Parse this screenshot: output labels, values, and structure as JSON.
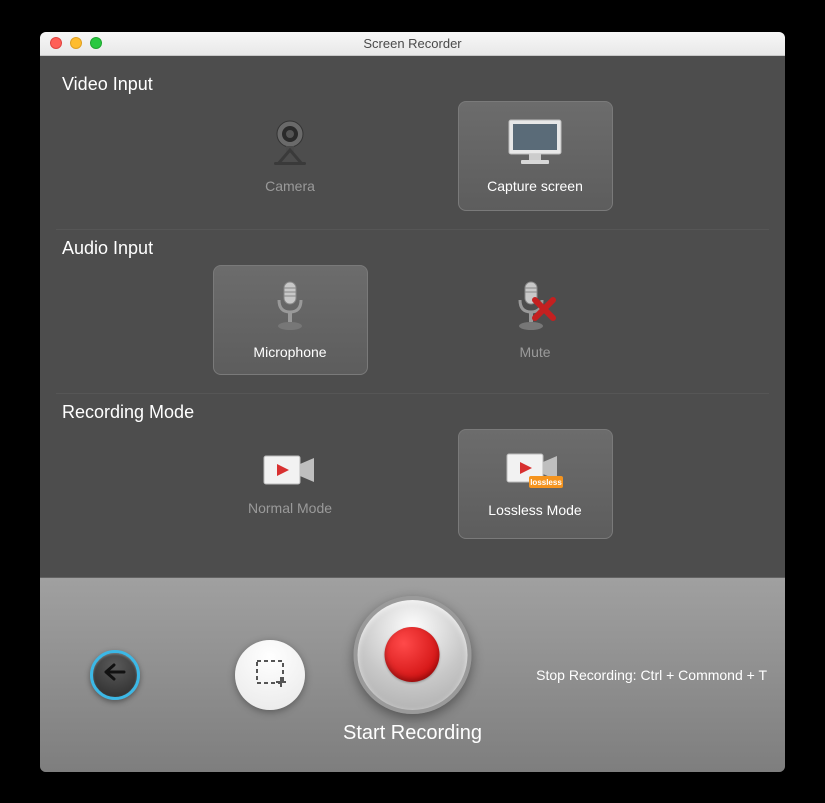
{
  "window": {
    "title": "Screen Recorder"
  },
  "sections": {
    "video": {
      "title": "Video Input",
      "camera": "Camera",
      "capture": "Capture screen"
    },
    "audio": {
      "title": "Audio Input",
      "microphone": "Microphone",
      "mute": "Mute"
    },
    "mode": {
      "title": "Recording Mode",
      "normal": "Normal Mode",
      "lossless": "Lossless Mode",
      "lossless_badge": "lossless"
    }
  },
  "footer": {
    "record_label": "Start Recording",
    "shortcut": "Stop Recording: Ctrl + Commond + T"
  },
  "state": {
    "video_selected": "capture",
    "audio_selected": "microphone",
    "mode_selected": "lossless"
  }
}
